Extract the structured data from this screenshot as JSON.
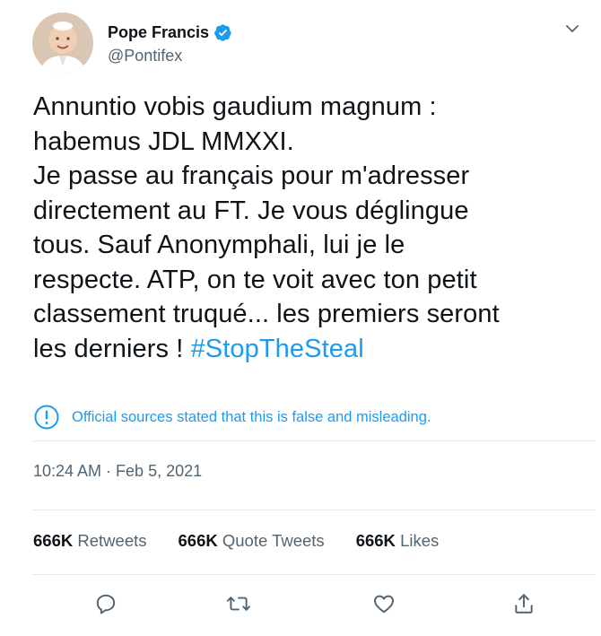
{
  "author": {
    "display_name": "Pope Francis",
    "handle": "@Pontifex",
    "verified": true,
    "avatar_icon": "pope-portrait"
  },
  "tweet": {
    "lines": [
      "Annuntio vobis gaudium magnum :",
      "habemus JDL MMXXI.",
      "Je passe au français pour m'adresser",
      "directement au FT. Je vous déglingue",
      "tous. Sauf Anonymphali, lui je le",
      "respecte. ATP, on te voit avec ton petit",
      "classement truqué... les premiers seront"
    ],
    "last_line_prefix": "les derniers ! ",
    "hashtag": "#StopTheSteal"
  },
  "notice": {
    "text": "Official sources stated that this is false and misleading.",
    "icon": "exclamation-circle-icon"
  },
  "timestamp": "10:24 AM · Feb 5, 2021",
  "stats": {
    "retweets_count": "666K",
    "retweets_label": "Retweets",
    "quotes_count": "666K",
    "quotes_label": "Quote Tweets",
    "likes_count": "666K",
    "likes_label": "Likes"
  },
  "colors": {
    "accent": "#1d9bf0",
    "text": "#0f1419",
    "secondary": "#536471",
    "divider": "#e6ecf0"
  },
  "actions": [
    "reply-icon",
    "retweet-icon",
    "like-icon",
    "share-icon"
  ]
}
